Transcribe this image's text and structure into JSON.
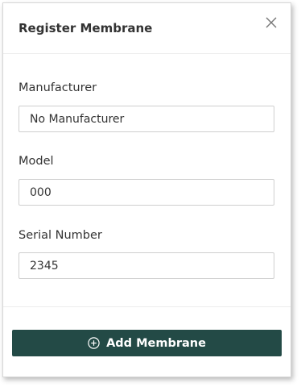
{
  "dialog": {
    "title": "Register Membrane",
    "close_icon": "close-icon"
  },
  "fields": {
    "manufacturer": {
      "label": "Manufacturer",
      "value": "No Manufacturer"
    },
    "model": {
      "label": "Model",
      "value": "000"
    },
    "serial_number": {
      "label": "Serial Number",
      "value": "2345"
    }
  },
  "actions": {
    "add_label": "Add Membrane",
    "add_icon": "plus-circle-icon",
    "button_color": "#234a46"
  }
}
